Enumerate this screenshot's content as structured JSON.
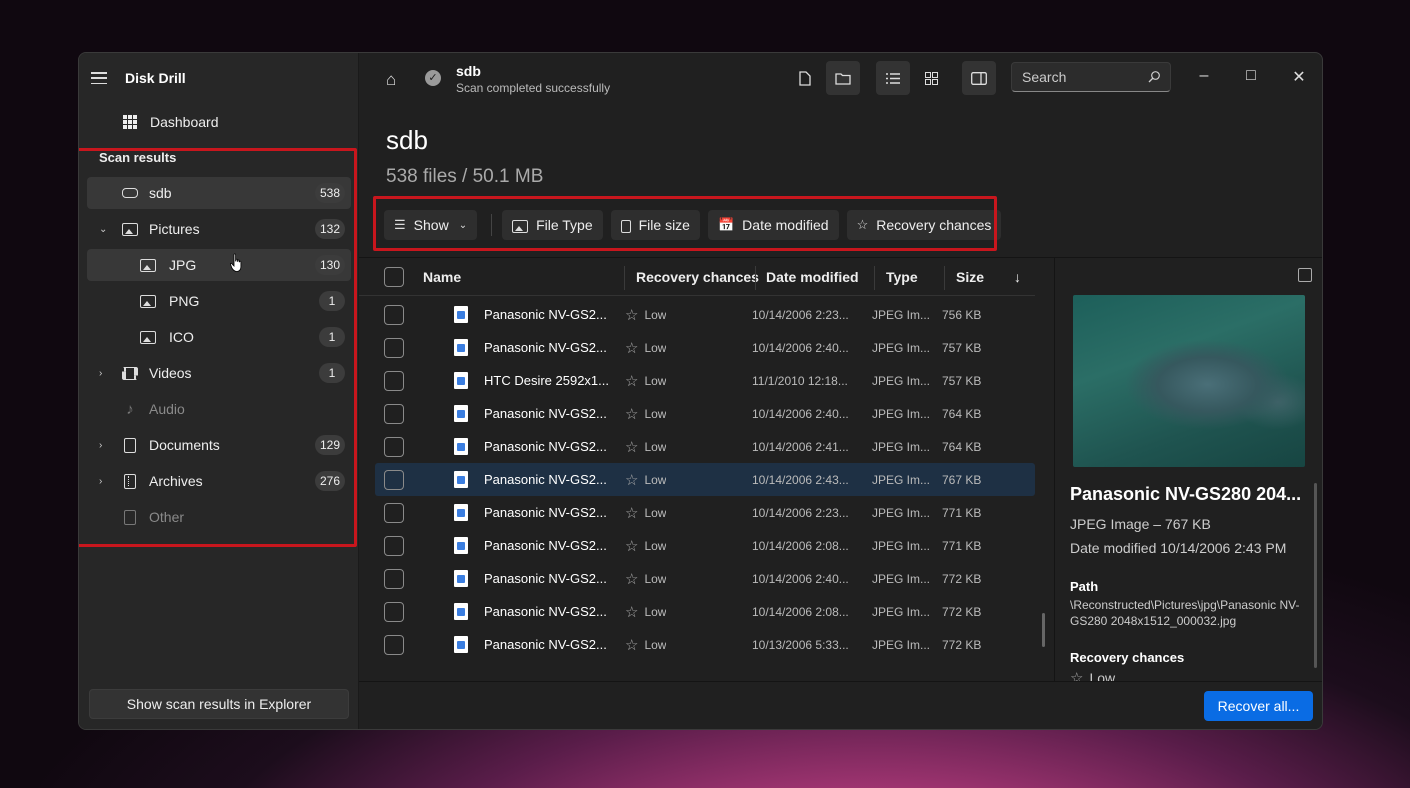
{
  "app": {
    "name": "Disk Drill"
  },
  "sidebar": {
    "dashboard_label": "Dashboard",
    "section_title": "Scan results",
    "items": [
      {
        "label": "sdb",
        "count": "538"
      },
      {
        "label": "Pictures",
        "count": "132"
      },
      {
        "label": "JPG",
        "count": "130"
      },
      {
        "label": "PNG",
        "count": "1"
      },
      {
        "label": "ICO",
        "count": "1"
      },
      {
        "label": "Videos",
        "count": "1"
      },
      {
        "label": "Audio",
        "count": ""
      },
      {
        "label": "Documents",
        "count": "129"
      },
      {
        "label": "Archives",
        "count": "276"
      },
      {
        "label": "Other",
        "count": ""
      }
    ],
    "explorer_button": "Show scan results in Explorer"
  },
  "header": {
    "drive_name": "sdb",
    "status": "Scan completed successfully",
    "search_placeholder": "Search"
  },
  "main": {
    "title": "sdb",
    "summary": "538 files / 50.1 MB"
  },
  "filters": {
    "show": "Show",
    "file_type": "File Type",
    "file_size": "File size",
    "date_modified": "Date modified",
    "recovery_chances": "Recovery chances"
  },
  "table": {
    "columns": {
      "name": "Name",
      "recovery": "Recovery chances",
      "date": "Date modified",
      "type": "Type",
      "size": "Size"
    },
    "rows": [
      {
        "name": "Panasonic NV-GS2...",
        "recovery": "Low",
        "date": "10/14/2006 2:23...",
        "type": "JPEG Im...",
        "size": "756 KB"
      },
      {
        "name": "Panasonic NV-GS2...",
        "recovery": "Low",
        "date": "10/14/2006 2:40...",
        "type": "JPEG Im...",
        "size": "757 KB"
      },
      {
        "name": "HTC Desire 2592x1...",
        "recovery": "Low",
        "date": "11/1/2010 12:18...",
        "type": "JPEG Im...",
        "size": "757 KB"
      },
      {
        "name": "Panasonic NV-GS2...",
        "recovery": "Low",
        "date": "10/14/2006 2:40...",
        "type": "JPEG Im...",
        "size": "764 KB"
      },
      {
        "name": "Panasonic NV-GS2...",
        "recovery": "Low",
        "date": "10/14/2006 2:41...",
        "type": "JPEG Im...",
        "size": "764 KB"
      },
      {
        "name": "Panasonic NV-GS2...",
        "recovery": "Low",
        "date": "10/14/2006 2:43...",
        "type": "JPEG Im...",
        "size": "767 KB"
      },
      {
        "name": "Panasonic NV-GS2...",
        "recovery": "Low",
        "date": "10/14/2006 2:23...",
        "type": "JPEG Im...",
        "size": "771 KB"
      },
      {
        "name": "Panasonic NV-GS2...",
        "recovery": "Low",
        "date": "10/14/2006 2:08...",
        "type": "JPEG Im...",
        "size": "771 KB"
      },
      {
        "name": "Panasonic NV-GS2...",
        "recovery": "Low",
        "date": "10/14/2006 2:40...",
        "type": "JPEG Im...",
        "size": "772 KB"
      },
      {
        "name": "Panasonic NV-GS2...",
        "recovery": "Low",
        "date": "10/14/2006 2:08...",
        "type": "JPEG Im...",
        "size": "772 KB"
      },
      {
        "name": "Panasonic NV-GS2...",
        "recovery": "Low",
        "date": "10/13/2006 5:33...",
        "type": "JPEG Im...",
        "size": "772 KB"
      }
    ]
  },
  "preview": {
    "title": "Panasonic NV-GS280 204...",
    "type_size": "JPEG Image – 767 KB",
    "date_modified": "Date modified 10/14/2006 2:43 PM",
    "path_label": "Path",
    "path": "\\Reconstructed\\Pictures\\jpg\\Panasonic NV-GS280 2048x1512_000032.jpg",
    "recovery_label": "Recovery chances",
    "recovery_value": "Low"
  },
  "footer": {
    "recover_button": "Recover all..."
  },
  "colors": {
    "accent": "#0a6ce4",
    "highlight_box": "#c8161d",
    "selected_row": "#1e3044"
  }
}
